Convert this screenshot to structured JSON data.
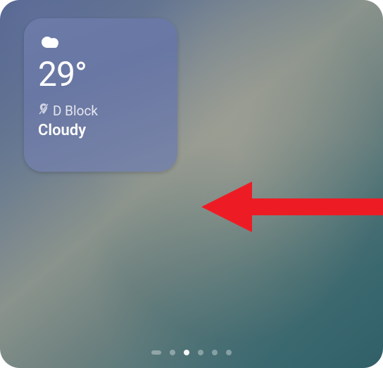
{
  "widget": {
    "temperature": "29°",
    "location": "D Block",
    "condition": "Cloudy"
  },
  "pager": {
    "total": 6,
    "active_index": 2
  },
  "annotation": {
    "arrow_color": "#ed1c24"
  }
}
